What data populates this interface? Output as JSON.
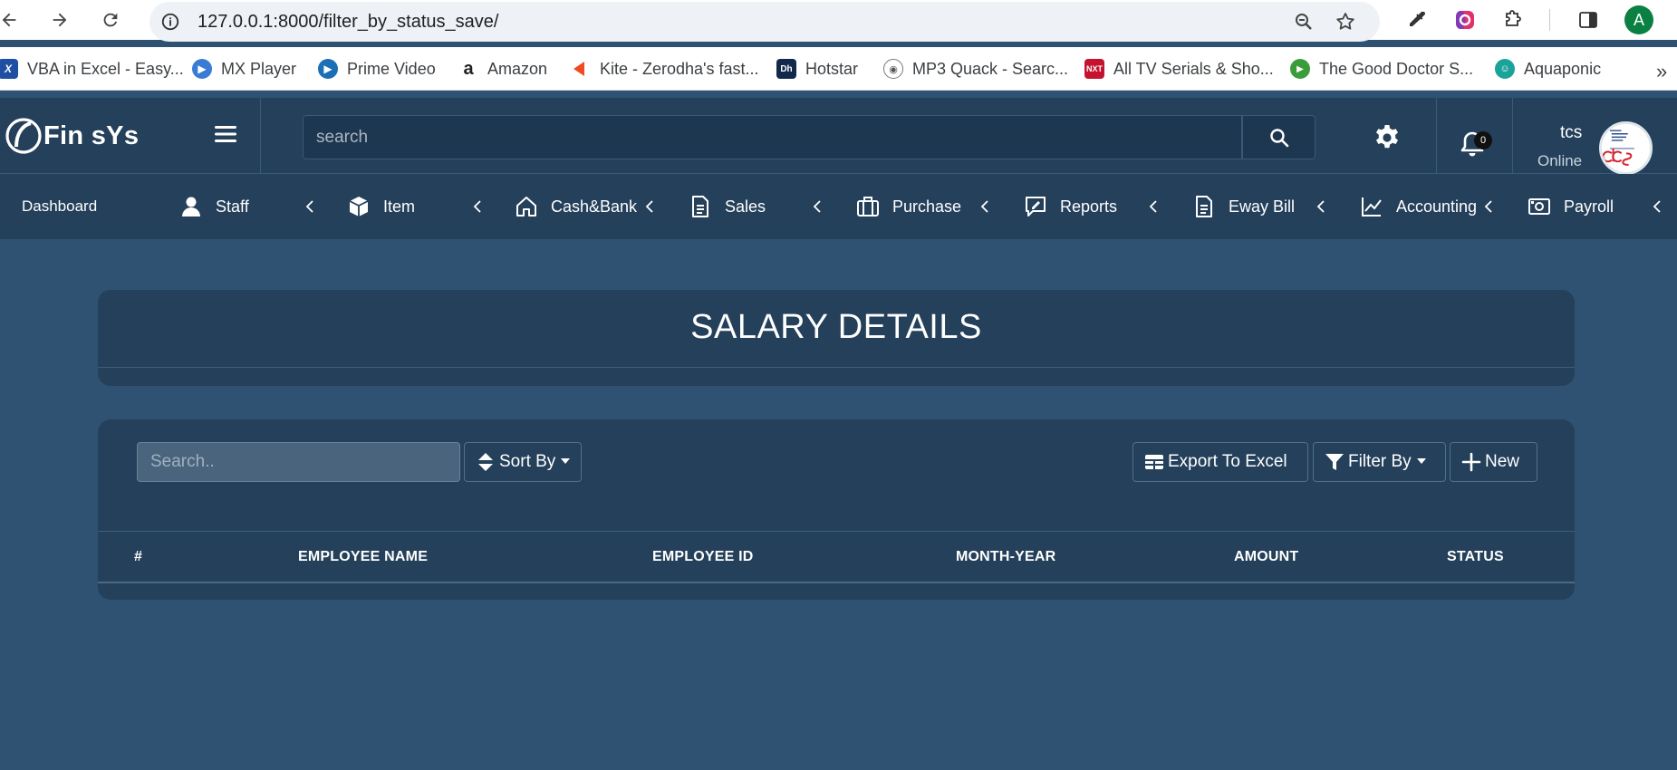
{
  "browser": {
    "url": "127.0.0.1:8000/filter_by_status_save/",
    "profile_initial": "A",
    "bookmarks": [
      {
        "label": "VBA in Excel - Easy...",
        "icon": "excel-icon",
        "color": "#1f4fa3"
      },
      {
        "label": "MX Player",
        "icon": "mx-player-icon",
        "color": "#3a7bd5"
      },
      {
        "label": "Prime Video",
        "icon": "prime-video-icon",
        "color": "#1a6fb5"
      },
      {
        "label": "Amazon",
        "icon": "amazon-icon",
        "color": "#222222"
      },
      {
        "label": "Kite - Zerodha's fast...",
        "icon": "kite-icon",
        "color": "#ef4b23"
      },
      {
        "label": "Hotstar",
        "icon": "hotstar-icon",
        "color": "#13294b"
      },
      {
        "label": "MP3 Quack - Searc...",
        "icon": "mp3-quack-icon",
        "color": "#888888"
      },
      {
        "label": "All TV Serials & Sho...",
        "icon": "tv-serials-icon",
        "color": "#c4122f"
      },
      {
        "label": "The Good Doctor S...",
        "icon": "good-doctor-icon",
        "color": "#3a9d3a"
      },
      {
        "label": "Aquaponic",
        "icon": "aquaponic-icon",
        "color": "#1aa39a"
      }
    ]
  },
  "header": {
    "brand": "Fin sYs",
    "search_placeholder": "search",
    "notification_count": "0",
    "user_name": "tcs",
    "user_status": "Online"
  },
  "nav": {
    "dashboard": "Dashboard",
    "items": [
      {
        "label": "Staff",
        "icon": "user-icon"
      },
      {
        "label": "Item",
        "icon": "box-icon"
      },
      {
        "label": "Cash&Bank",
        "icon": "home-icon"
      },
      {
        "label": "Sales",
        "icon": "document-icon"
      },
      {
        "label": "Purchase",
        "icon": "briefcase-icon"
      },
      {
        "label": "Reports",
        "icon": "chart-edit-icon"
      },
      {
        "label": "Eway Bill",
        "icon": "document-icon"
      },
      {
        "label": "Accounting",
        "icon": "line-chart-icon"
      },
      {
        "label": "Payroll",
        "icon": "money-icon"
      }
    ]
  },
  "page": {
    "title": "SALARY DETAILS"
  },
  "toolbar": {
    "search_placeholder": "Search..",
    "sort_label": "Sort By",
    "export_label": "Export To Excel",
    "filter_label": "Filter By",
    "new_label": "New"
  },
  "table": {
    "columns": [
      "#",
      "EMPLOYEE NAME",
      "EMPLOYEE ID",
      "MONTH-YEAR",
      "AMOUNT",
      "STATUS"
    ],
    "rows": []
  },
  "colors": {
    "page_bg": "#2f5272",
    "header_bg": "#24405a",
    "card_bg": "#24405a"
  }
}
